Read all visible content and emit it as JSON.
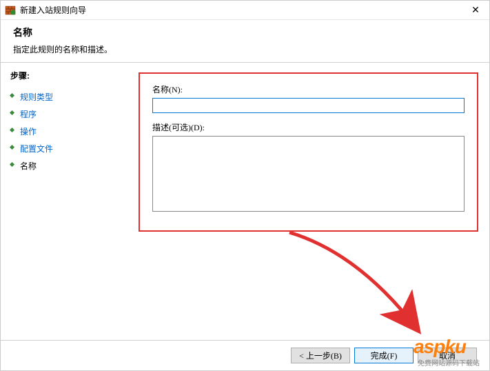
{
  "window": {
    "title": "新建入站规则向导",
    "close_glyph": "✕"
  },
  "header": {
    "title": "名称",
    "subtitle": "指定此规则的名称和描述。"
  },
  "sidebar": {
    "heading": "步骤:",
    "items": [
      {
        "label": "规则类型"
      },
      {
        "label": "程序"
      },
      {
        "label": "操作"
      },
      {
        "label": "配置文件"
      },
      {
        "label": "名称"
      }
    ]
  },
  "form": {
    "name_label": "名称(N):",
    "name_value": "",
    "desc_label": "描述(可选)(D):",
    "desc_value": ""
  },
  "footer": {
    "back": "< 上一步(B)",
    "finish": "完成(F)",
    "cancel": "取消"
  },
  "overlay": {
    "watermark_logo": "aspku",
    "watermark_sub": "免费网站源码下载站"
  }
}
